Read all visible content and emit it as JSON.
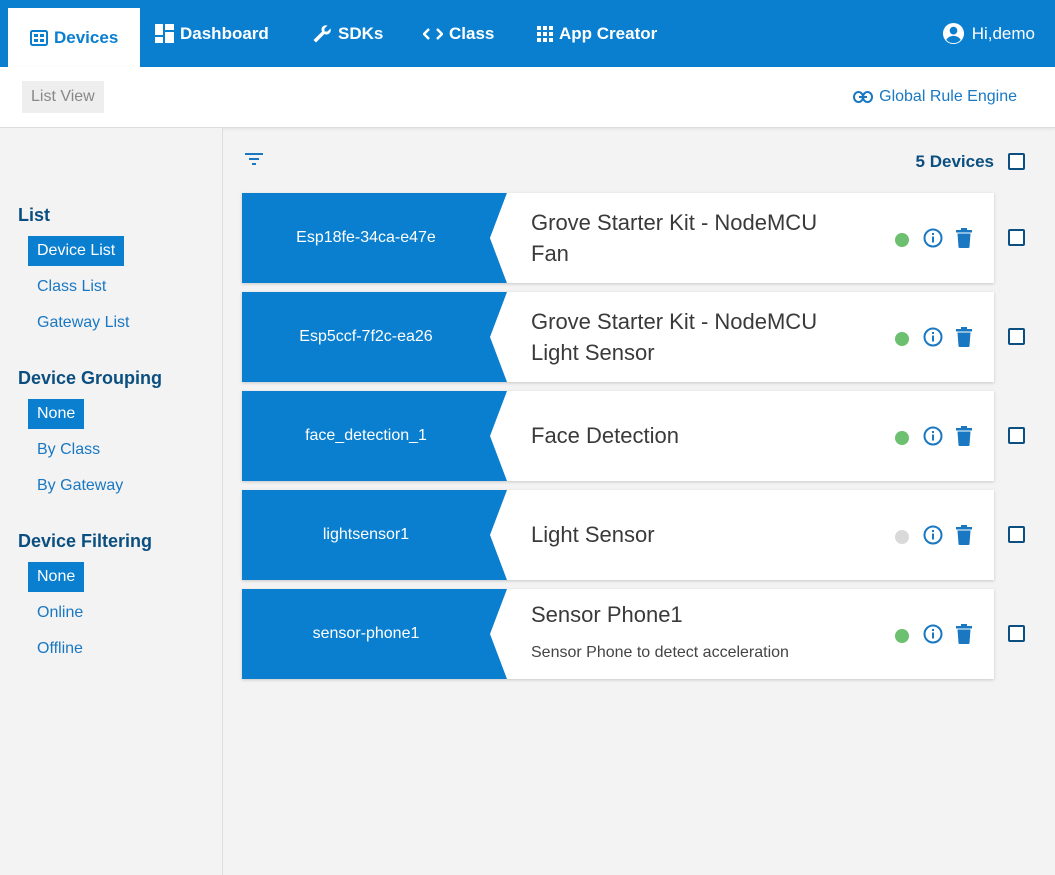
{
  "nav": {
    "tabs": [
      {
        "label": "Devices",
        "icon": "devices-icon"
      },
      {
        "label": "Dashboard",
        "icon": "dashboard-icon"
      },
      {
        "label": "SDKs",
        "icon": "wrench-icon"
      },
      {
        "label": "Class",
        "icon": "code-icon"
      },
      {
        "label": "App Creator",
        "icon": "grid-icon"
      }
    ],
    "user": "Hi,demo"
  },
  "subbar": {
    "list_view": "List View",
    "rule_engine": "Global Rule Engine"
  },
  "sidebar": {
    "list": {
      "heading": "List",
      "items": [
        "Device List",
        "Class List",
        "Gateway List"
      ],
      "selected": "Device List"
    },
    "grouping": {
      "heading": "Device Grouping",
      "items": [
        "None",
        "By Class",
        "By Gateway"
      ],
      "selected": "None"
    },
    "filtering": {
      "heading": "Device Filtering",
      "items": [
        "None",
        "Online",
        "Offline"
      ],
      "selected": "None"
    }
  },
  "main": {
    "device_count": "5 Devices",
    "devices": [
      {
        "id": "Esp18fe-34ca-e47e",
        "name_line1": "Grove Starter Kit - NodeMCU",
        "name_line2": "Fan",
        "description": "",
        "status": "online"
      },
      {
        "id": "Esp5ccf-7f2c-ea26",
        "name_line1": "Grove Starter Kit - NodeMCU",
        "name_line2": "Light Sensor",
        "description": "",
        "status": "online"
      },
      {
        "id": "face_detection_1",
        "name_line1": "Face Detection",
        "name_line2": "",
        "description": "",
        "status": "online"
      },
      {
        "id": "lightsensor1",
        "name_line1": "Light Sensor",
        "name_line2": "",
        "description": "",
        "status": "offline"
      },
      {
        "id": "sensor-phone1",
        "name_line1": "Sensor Phone1",
        "name_line2": "",
        "description": "Sensor Phone to detect acceleration",
        "status": "online"
      }
    ]
  },
  "colors": {
    "brand": "#0a7fcf",
    "heading": "#0b4f80",
    "link": "#1a78c2",
    "online": "#6cc070",
    "offline": "#d9d9d9"
  }
}
